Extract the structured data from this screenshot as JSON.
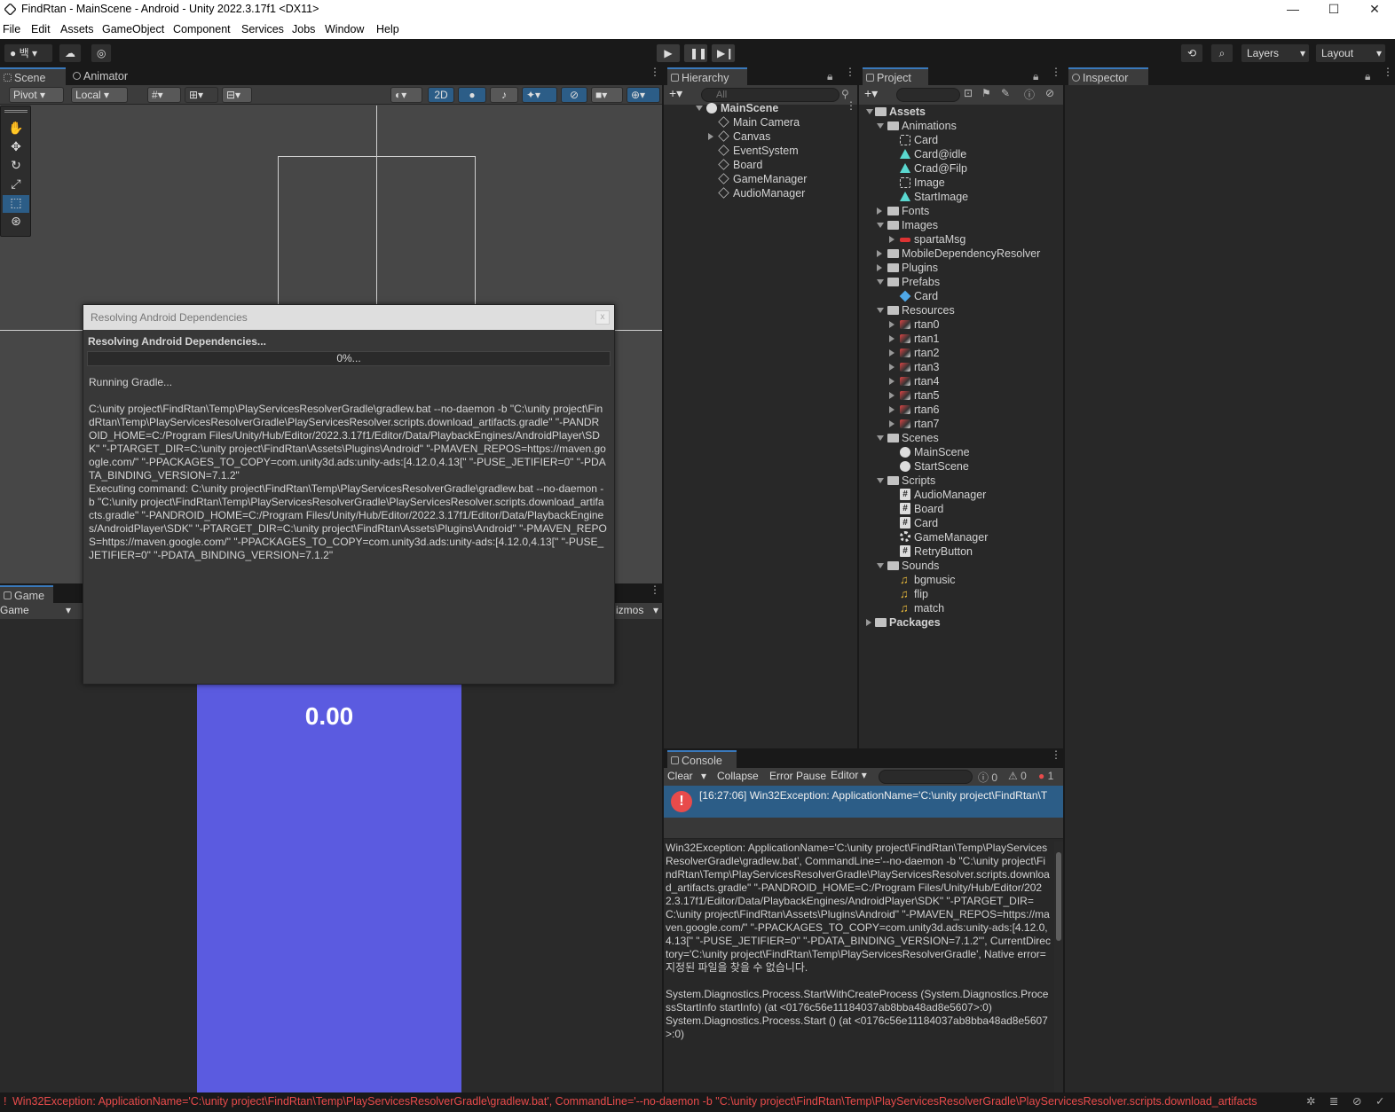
{
  "window": {
    "title": "FindRtan - MainScene - Android - Unity 2022.3.17f1 <DX11>",
    "minimize": "—",
    "maximize": "☐",
    "close": "✕"
  },
  "menu": [
    "File",
    "Edit",
    "Assets",
    "GameObject",
    "Component",
    "Services",
    "Jobs",
    "Window",
    "Help"
  ],
  "toolbar": {
    "account": "백",
    "layers": "Layers",
    "layout": "Layout"
  },
  "scene": {
    "tabs": [
      "Scene",
      "Animator"
    ],
    "pivot": "Pivot",
    "local": "Local",
    "mode2d": "2D"
  },
  "game": {
    "tab": "Game",
    "display": "Game",
    "gizmos": "izmos",
    "score": "0.00"
  },
  "hierarchy": {
    "tab": "Hierarchy",
    "search_placeholder": "All",
    "scene": "MainScene",
    "items": [
      "Main Camera",
      "Canvas",
      "EventSystem",
      "Board",
      "GameManager",
      "AudioManager"
    ]
  },
  "project": {
    "tab": "Project",
    "assets": "Assets",
    "packages": "Packages",
    "rows": [
      "Animations",
      "Card",
      "Card@idle",
      "Crad@Filp",
      "Image",
      "StartImage",
      "Fonts",
      "Images",
      "spartaMsg",
      "MobileDependencyResolver",
      "Plugins",
      "Prefabs",
      "Card",
      "Resources",
      "rtan0",
      "rtan1",
      "rtan2",
      "rtan3",
      "rtan4",
      "rtan5",
      "rtan6",
      "rtan7",
      "Scenes",
      "MainScene",
      "StartScene",
      "Scripts",
      "AudioManager",
      "Board",
      "Card",
      "GameManager",
      "RetryButton",
      "Sounds",
      "bgmusic",
      "flip",
      "match"
    ]
  },
  "inspector": {
    "tab": "Inspector"
  },
  "console": {
    "tab": "Console",
    "clear": "Clear",
    "collapse": "Collapse",
    "error_pause": "Error Pause",
    "editor": "Editor",
    "count_info": "0",
    "count_warn": "0",
    "count_err": "1",
    "entry": "[16:27:06] Win32Exception: ApplicationName='C:\\unity project\\FindRtan\\T",
    "detail": "Win32Exception: ApplicationName='C:\\unity project\\FindRtan\\Temp\\PlayServicesResolverGradle\\gradlew.bat', CommandLine='--no-daemon -b \"C:\\unity project\\FindRtan\\Temp\\PlayServicesResolverGradle\\PlayServicesResolver.scripts.download_artifacts.gradle\" \"-PANDROID_HOME=C:/Program Files/Unity/Hub/Editor/2022.3.17f1/Editor/Data/PlaybackEngines/AndroidPlayer\\SDK\" \"-PTARGET_DIR=C:\\unity project\\FindRtan\\Assets\\Plugins\\Android\" \"-PMAVEN_REPOS=https://maven.google.com/\" \"-PPACKAGES_TO_COPY=com.unity3d.ads:unity-ads:[4.12.0,4.13[\" \"-PUSE_JETIFIER=0\" \"-PDATA_BINDING_VERSION=7.1.2\"', CurrentDirectory='C:\\unity project\\FindRtan\\Temp\\PlayServicesResolverGradle', Native error= 지정된 파일을 찾을 수 없습니다.\n\nSystem.Diagnostics.Process.StartWithCreateProcess (System.Diagnostics.ProcessStartInfo startInfo) (at <0176c56e11184037ab8bba48ad8e5607>:0)\nSystem.Diagnostics.Process.Start () (at <0176c56e11184037ab8bba48ad8e5607>:0)"
  },
  "dialog": {
    "title": "Resolving Android Dependencies",
    "close": "x",
    "heading": "Resolving Android Dependencies...",
    "progress": "0%...",
    "progress_value": 0,
    "log": "Running Gradle...\n\nC:\\unity project\\FindRtan\\Temp\\PlayServicesResolverGradle\\gradlew.bat --no-daemon -b \"C:\\unity project\\FindRtan\\Temp\\PlayServicesResolverGradle\\PlayServicesResolver.scripts.download_artifacts.gradle\" \"-PANDROID_HOME=C:/Program Files/Unity/Hub/Editor/2022.3.17f1/Editor/Data/PlaybackEngines/AndroidPlayer\\SDK\" \"-PTARGET_DIR=C:\\unity project\\FindRtan\\Assets\\Plugins\\Android\" \"-PMAVEN_REPOS=https://maven.google.com/\" \"-PPACKAGES_TO_COPY=com.unity3d.ads:unity-ads:[4.12.0,4.13[\" \"-PUSE_JETIFIER=0\" \"-PDATA_BINDING_VERSION=7.1.2\"\nExecuting command: C:\\unity project\\FindRtan\\Temp\\PlayServicesResolverGradle\\gradlew.bat --no-daemon -b \"C:\\unity project\\FindRtan\\Temp\\PlayServicesResolverGradle\\PlayServicesResolver.scripts.download_artifacts.gradle\" \"-PANDROID_HOME=C:/Program Files/Unity/Hub/Editor/2022.3.17f1/Editor/Data/PlaybackEngines/AndroidPlayer\\SDK\" \"-PTARGET_DIR=C:\\unity project\\FindRtan\\Assets\\Plugins\\Android\" \"-PMAVEN_REPOS=https://maven.google.com/\" \"-PPACKAGES_TO_COPY=com.unity3d.ads:unity-ads:[4.12.0,4.13[\" \"-PUSE_JETIFIER=0\" \"-PDATA_BINDING_VERSION=7.1.2\""
  },
  "status": {
    "message": "Win32Exception: ApplicationName='C:\\unity project\\FindRtan\\Temp\\PlayServicesResolverGradle\\gradlew.bat', CommandLine='--no-daemon -b \"C:\\unity project\\FindRtan\\Temp\\PlayServicesResolverGradle\\PlayServicesResolver.scripts.download_artifacts"
  },
  "colors": {
    "accent": "#3a79bb",
    "error": "#e84b4b",
    "game_bg": "#5b5be0",
    "selection": "#2c5d87"
  }
}
